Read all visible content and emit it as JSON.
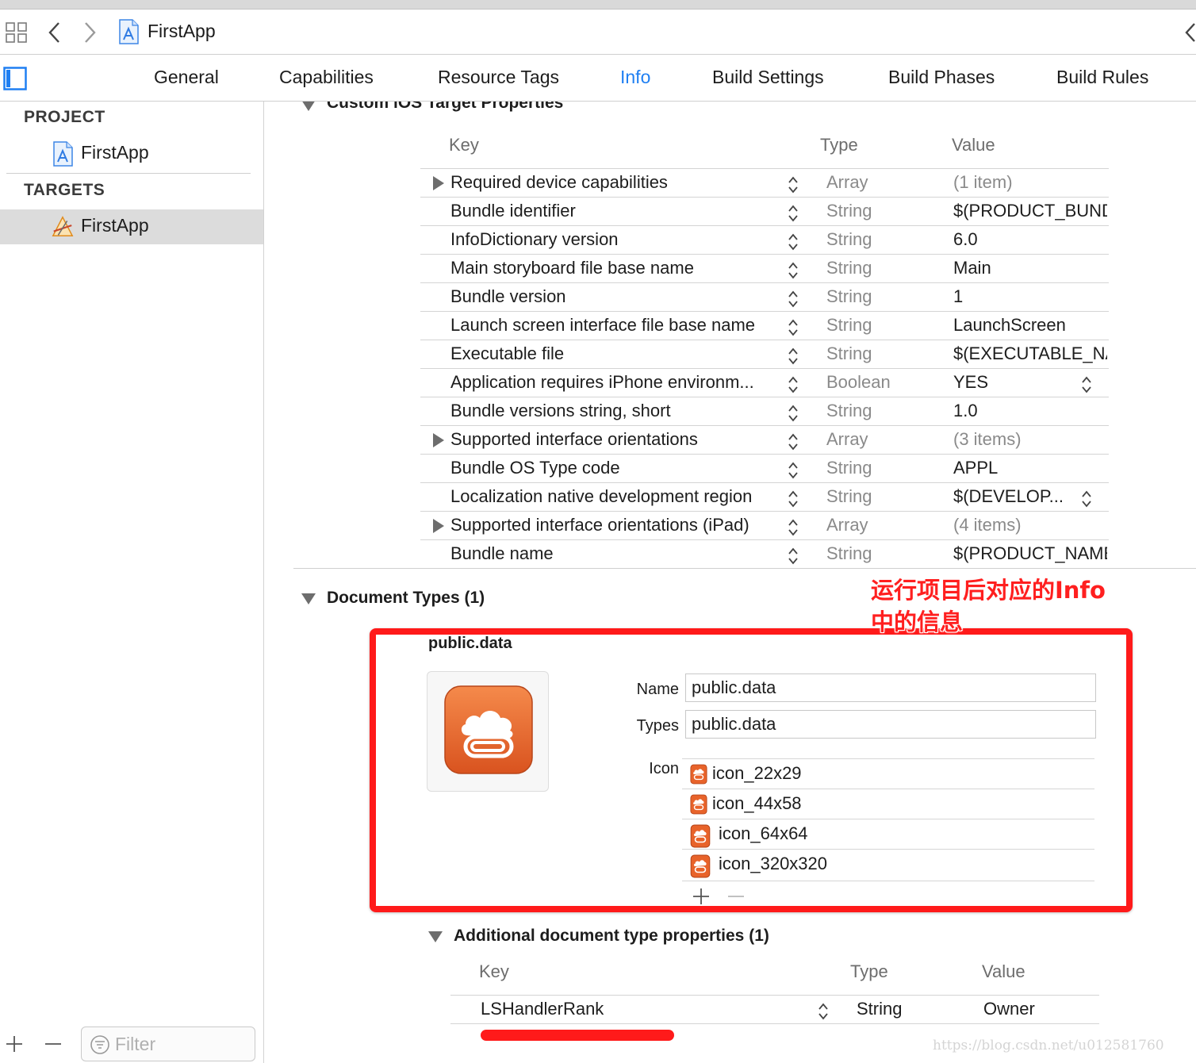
{
  "toolbar": {
    "title": "FirstApp",
    "icons": [
      "grid-icon",
      "chevron-left-icon",
      "chevron-right-icon",
      "app-project-file-icon",
      "chevron-left-icon"
    ]
  },
  "tabs": [
    {
      "label": "General",
      "active": false
    },
    {
      "label": "Capabilities",
      "active": false
    },
    {
      "label": "Resource Tags",
      "active": false
    },
    {
      "label": "Info",
      "active": true
    },
    {
      "label": "Build Settings",
      "active": false
    },
    {
      "label": "Build Phases",
      "active": false
    },
    {
      "label": "Build Rules",
      "active": false
    }
  ],
  "sidebar": {
    "project_header": "PROJECT",
    "project_item": "FirstApp",
    "targets_header": "TARGETS",
    "target_item": "FirstApp",
    "filter_placeholder": "Filter"
  },
  "custom_properties": {
    "title": "Custom iOS Target Properties",
    "columns": {
      "key": "Key",
      "type": "Type",
      "value": "Value"
    },
    "rows": [
      {
        "key": "Required device capabilities",
        "type": "Array",
        "value": "(1 item)",
        "expandable": true
      },
      {
        "key": "Bundle identifier",
        "type": "String",
        "value": "$(PRODUCT_BUNDLE_IDENTIFIER)",
        "expandable": false
      },
      {
        "key": "InfoDictionary version",
        "type": "String",
        "value": "6.0",
        "expandable": false
      },
      {
        "key": "Main storyboard file base name",
        "type": "String",
        "value": "Main",
        "expandable": false
      },
      {
        "key": "Bundle version",
        "type": "String",
        "value": "1",
        "expandable": false
      },
      {
        "key": "Launch screen interface file base name",
        "type": "String",
        "value": "LaunchScreen",
        "expandable": false
      },
      {
        "key": "Executable file",
        "type": "String",
        "value": "$(EXECUTABLE_NAME)",
        "expandable": false
      },
      {
        "key": "Application requires iPhone environm...",
        "type": "Boolean",
        "value": "YES",
        "expandable": false,
        "value_stepper": true
      },
      {
        "key": "Bundle versions string, short",
        "type": "String",
        "value": "1.0",
        "expandable": false
      },
      {
        "key": "Supported interface orientations",
        "type": "Array",
        "value": "(3 items)",
        "expandable": true
      },
      {
        "key": "Bundle OS Type code",
        "type": "String",
        "value": "APPL",
        "expandable": false
      },
      {
        "key": "Localization native development region",
        "type": "String",
        "value": "$(DEVELOP...",
        "expandable": false,
        "value_stepper": true
      },
      {
        "key": "Supported interface orientations (iPad)",
        "type": "Array",
        "value": "(4 items)",
        "expandable": true
      },
      {
        "key": "Bundle name",
        "type": "String",
        "value": "$(PRODUCT_NAME)",
        "expandable": false
      }
    ]
  },
  "document_types": {
    "title": "Document Types (1)",
    "doc_name": "public.data",
    "name_label": "Name",
    "name_value": "public.data",
    "types_label": "Types",
    "types_value": "public.data",
    "icon_label": "Icon",
    "icons": [
      "icon_22x29",
      "icon_44x58",
      "icon_64x64",
      "icon_320x320"
    ]
  },
  "annotation": {
    "text": "运行项目后对应的Info中的信息",
    "color": "#ff1f1f"
  },
  "additional": {
    "title": "Additional document type properties (1)",
    "columns": {
      "key": "Key",
      "type": "Type",
      "value": "Value"
    },
    "row": {
      "key": "LSHandlerRank",
      "type": "String",
      "value": "Owner"
    }
  },
  "watermark": "https://blog.csdn.net/u012581760",
  "colors": {
    "accent": "#1f7ff2",
    "annotation_red": "#ff1a1a",
    "doc_icon_orange": "#e8632a"
  }
}
